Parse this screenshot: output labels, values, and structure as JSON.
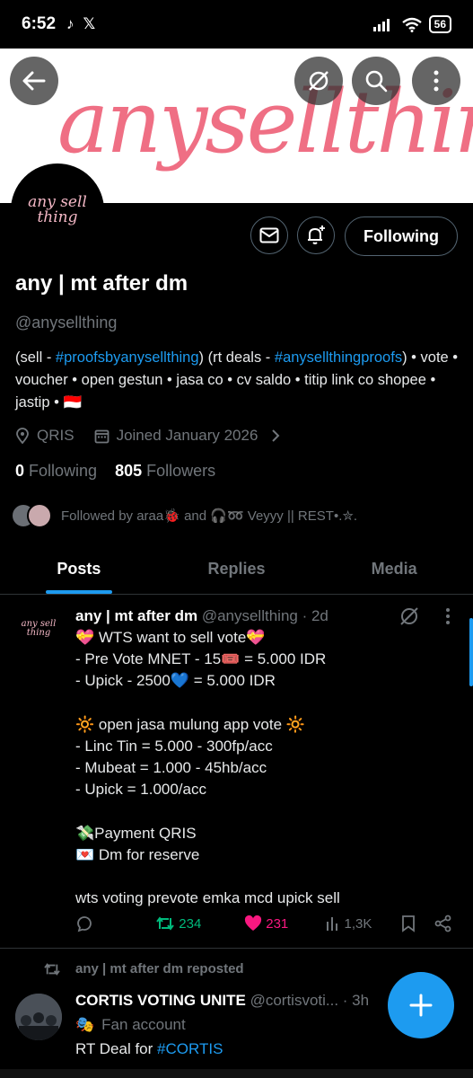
{
  "status_bar": {
    "time": "6:52",
    "app_icons": [
      "♪",
      "𝕏"
    ],
    "battery": "56"
  },
  "banner": {
    "text": "anysellthing",
    "bg_color": "#ffffff",
    "text_color": "#ef6f84"
  },
  "profile": {
    "avatar_text": "any sell thing",
    "name": "any | mt after dm",
    "handle": "@anysellthing",
    "follow_label": "Following",
    "bio_parts": {
      "p1": "(sell - ",
      "link1": "#proofsbyanysellthing",
      "p2": ") (rt deals - ",
      "link2": "#anysellthingproofs",
      "p3": ") • vote • voucher • open gestun • jasa co • cv saldo • titip link co shopee • jastip • 🇮🇩"
    },
    "location": "QRIS",
    "joined": "Joined January 2026",
    "following_count": "0",
    "following_label": "Following",
    "followers_count": "805",
    "followers_label": "Followers",
    "followed_by": "Followed by araa🐞 and 🎧➿ Veyyy || REST•.✮."
  },
  "tabs": [
    {
      "label": "Posts"
    },
    {
      "label": "Replies"
    },
    {
      "label": "Media"
    }
  ],
  "tweet": {
    "avatar_text": "any sell thing",
    "name": "any | mt after dm",
    "handle": "@anysellthing · 2d",
    "body": "💝 WTS want to sell vote💝\n- Pre Vote MNET - 15🎟️ = 5.000 IDR\n- Upick - 2500💙 = 5.000 IDR\n\n🔆 open jasa mulung app vote 🔆\n- Linc Tin = 5.000 - 300fp/acc\n- Mubeat = 1.000 - 45hb/acc\n- Upick = 1.000/acc\n\n💸Payment QRIS\n💌 Dm for reserve\n\nwts voting prevote emka mcd upick sell",
    "retweets": "234",
    "likes": "231",
    "views": "1,3K"
  },
  "retweet": {
    "label": "any | mt after dm reposted",
    "name": "CORTIS VOTING UNITE",
    "handle": "@cortisvoti... · 3h",
    "tag": "Fan account",
    "tag_emoji": "🎭",
    "body_prefix": "RT Deal for ",
    "body_link": "#CORTIS"
  },
  "colors": {
    "accent": "#1d9bf0",
    "retweet": "#00ba7c",
    "like": "#f91880",
    "muted": "#71767b"
  }
}
